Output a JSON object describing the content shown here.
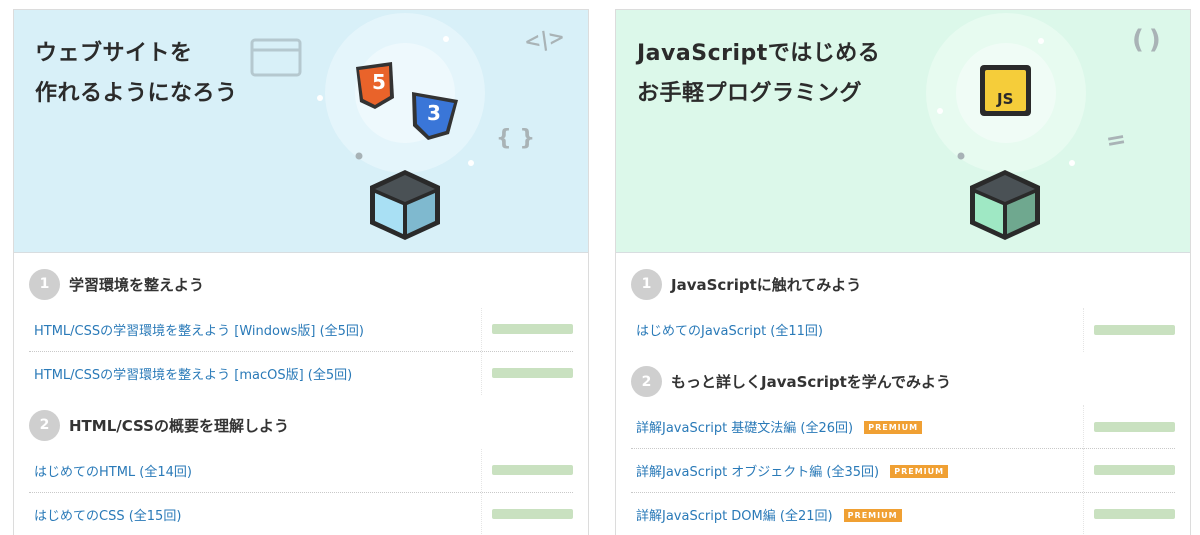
{
  "left_card": {
    "hero": {
      "title_line1": "ウェブサイトを",
      "title_line2": "作れるようになろう",
      "badge1": "5",
      "badge2": "3",
      "deco1": "<|>",
      "deco2": "{ }",
      "bg_color": "#d8f0f8"
    },
    "sections": [
      {
        "num": "1",
        "title": "学習環境を整えよう",
        "courses": [
          {
            "title": "HTML/CSSの学習環境を整えよう [Windows版] (全5回)",
            "progress": 0
          },
          {
            "title": "HTML/CSSの学習環境を整えよう [macOS版] (全5回)",
            "progress": 0
          }
        ]
      },
      {
        "num": "2",
        "title": "HTML/CSSの概要を理解しよう",
        "courses": [
          {
            "title": "はじめてのHTML (全14回)",
            "progress": 0
          },
          {
            "title": "はじめてのCSS (全15回)",
            "progress": 0
          }
        ]
      }
    ]
  },
  "right_card": {
    "hero": {
      "title_line1": "JavaScriptではじめる",
      "title_line2": "お手軽プログラミング",
      "badge": "JS",
      "deco1": "( )",
      "deco2": "=",
      "bg_color": "#dcf8ea"
    },
    "sections": [
      {
        "num": "1",
        "title": "JavaScriptに触れてみよう",
        "courses": [
          {
            "title": "はじめてのJavaScript (全11回)",
            "progress": 0,
            "premium": false
          }
        ]
      },
      {
        "num": "2",
        "title": "もっと詳しくJavaScriptを学んでみよう",
        "courses": [
          {
            "title": "詳解JavaScript 基礎文法編 (全26回)",
            "progress": 0,
            "premium": true
          },
          {
            "title": "詳解JavaScript オブジェクト編 (全35回)",
            "progress": 0,
            "premium": true
          },
          {
            "title": "詳解JavaScript DOM編 (全21回)",
            "progress": 0,
            "premium": true
          }
        ]
      }
    ]
  },
  "premium_label": "PREMIUM",
  "colors": {
    "link": "#2a7ab8",
    "premium": "#f0a033",
    "progress_track": "#c9e1c0",
    "section_circle": "#cfcfcf"
  }
}
